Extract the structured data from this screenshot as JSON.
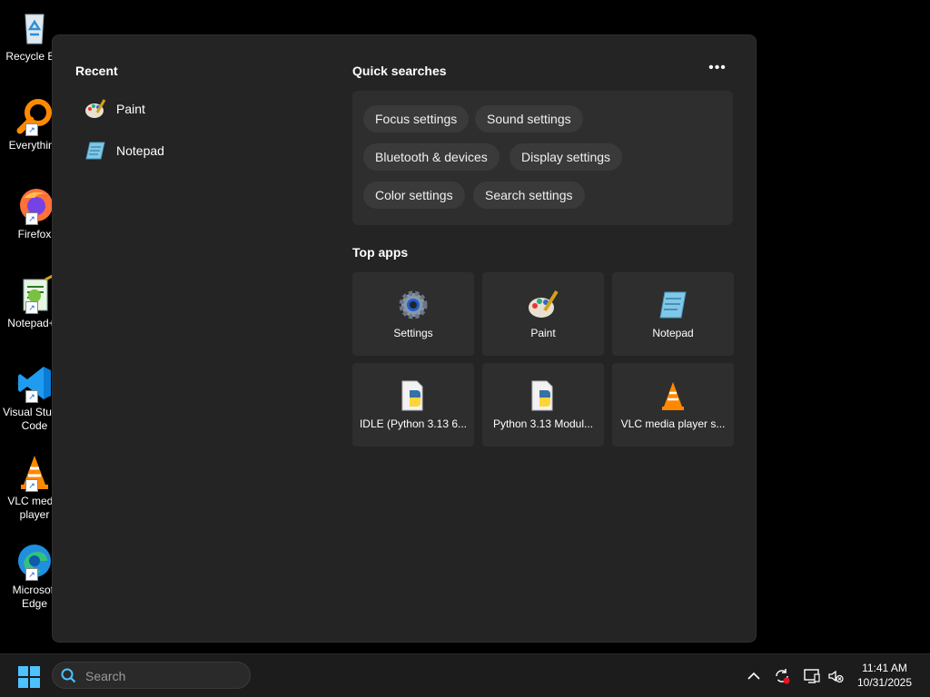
{
  "desktop": {
    "icons": [
      {
        "label": "Recycle Bin",
        "icon": "recycle-bin-icon"
      },
      {
        "label": "Everything",
        "icon": "everything-search-icon"
      },
      {
        "label": "Firefox",
        "icon": "firefox-icon"
      },
      {
        "label": "Notepad++",
        "icon": "notepad-plus-plus-icon"
      },
      {
        "label": "Visual Studio Code",
        "icon": "vscode-icon"
      },
      {
        "label": "VLC media player",
        "icon": "vlc-icon"
      },
      {
        "label": "Microsoft Edge",
        "icon": "edge-icon"
      }
    ]
  },
  "start": {
    "recent_title": "Recent",
    "recent": [
      {
        "label": "Paint",
        "icon": "paint-icon"
      },
      {
        "label": "Notepad",
        "icon": "notepad-icon"
      }
    ],
    "quick_title": "Quick searches",
    "more_label": "•••",
    "quick": [
      "Focus settings",
      "Sound settings",
      "Bluetooth & devices",
      "Display settings",
      "Color settings",
      "Search settings"
    ],
    "top_title": "Top apps",
    "top_apps": [
      {
        "label": "Settings",
        "icon": "settings-gear-icon"
      },
      {
        "label": "Paint",
        "icon": "paint-icon"
      },
      {
        "label": "Notepad",
        "icon": "notepad-icon"
      },
      {
        "label": "IDLE (Python 3.13 6...",
        "icon": "python-file-icon"
      },
      {
        "label": "Python 3.13 Modul...",
        "icon": "python-file-icon"
      },
      {
        "label": "VLC media player s...",
        "icon": "vlc-icon"
      }
    ]
  },
  "taskbar": {
    "search_placeholder": "Search",
    "time": "11:41 AM",
    "date": "10/31/2025"
  },
  "colors": {
    "panel_bg": "#242424",
    "chip_bg": "#3a3a3a",
    "accent_blue": "#0078d4"
  }
}
